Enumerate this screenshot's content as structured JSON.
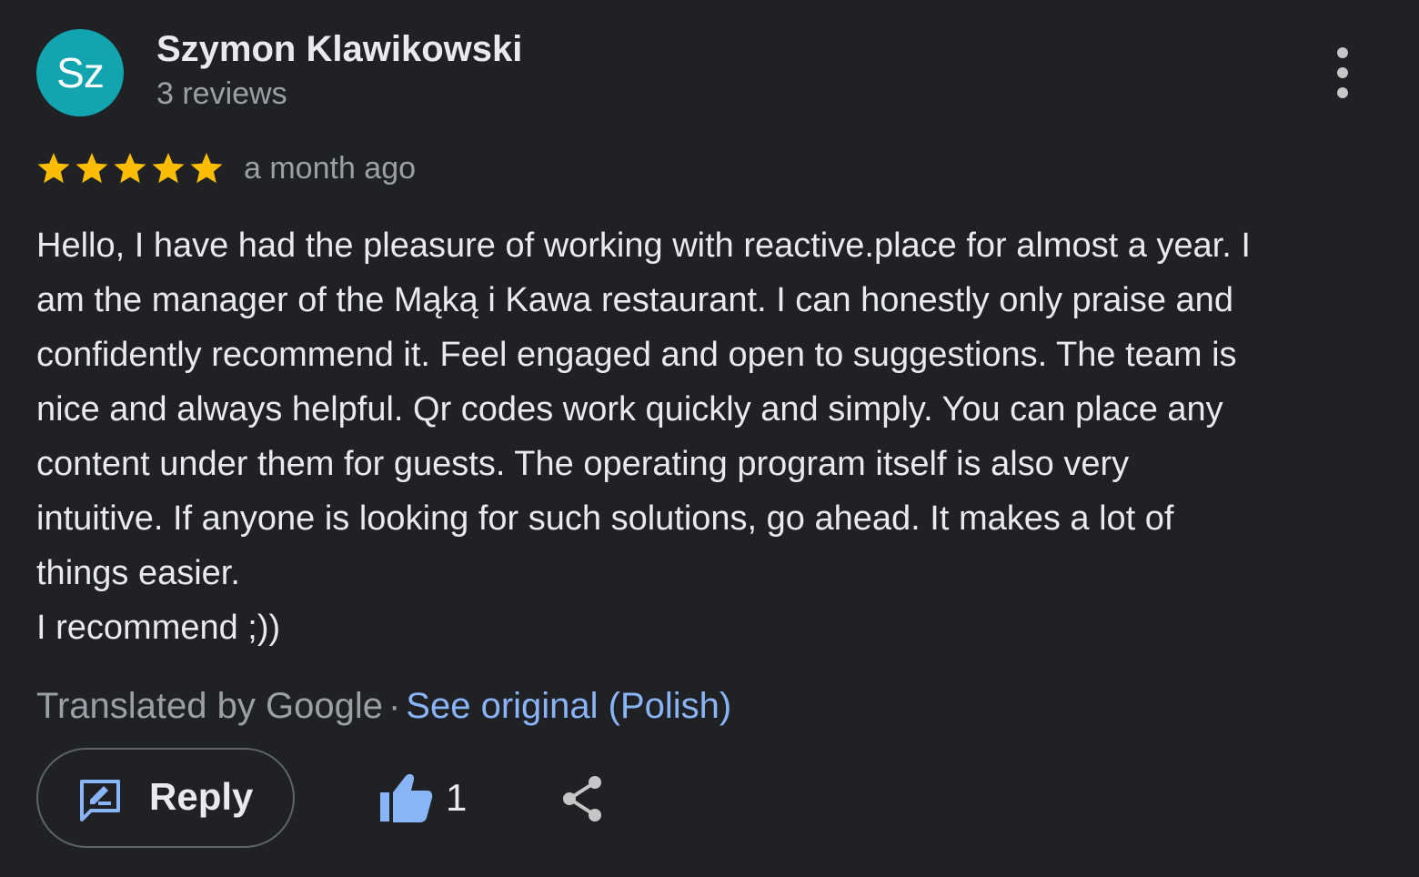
{
  "review": {
    "author": {
      "initials": "Sz",
      "name": "Szymon Klawikowski",
      "reviews_count": "3 reviews",
      "avatar_color": "#12a4af"
    },
    "rating": 5,
    "max_rating": 5,
    "star_color": "#fbbc04",
    "time_ago": "a month ago",
    "text_lines": [
      "Hello, I have had the pleasure of working with reactive.place for almost a year. I",
      "am the manager of the Mąką i Kawa restaurant. I can honestly only praise and",
      "confidently recommend it. Feel engaged and open to suggestions. The team is",
      "nice and always helpful. Qr codes work quickly and simply. You can place any",
      "content under them for guests. The operating program itself is also very",
      "intuitive. If anyone is looking for such solutions, go ahead. It makes a lot of",
      "things easier.",
      "I recommend ;))"
    ],
    "translation": {
      "translated_by": "Translated by Google",
      "separator": "·",
      "see_original": "See original (Polish)"
    },
    "actions": {
      "reply_label": "Reply",
      "like_count": "1"
    },
    "icons": {
      "more": "more-vertical-icon",
      "reply": "reply-edit-icon",
      "like": "thumbs-up-icon",
      "share": "share-icon",
      "star": "star-icon"
    },
    "colors": {
      "background": "#202124",
      "primary_text": "#e8eaed",
      "secondary_text": "#9aa0a6",
      "link": "#8ab4f8",
      "border": "#5f6368"
    }
  }
}
